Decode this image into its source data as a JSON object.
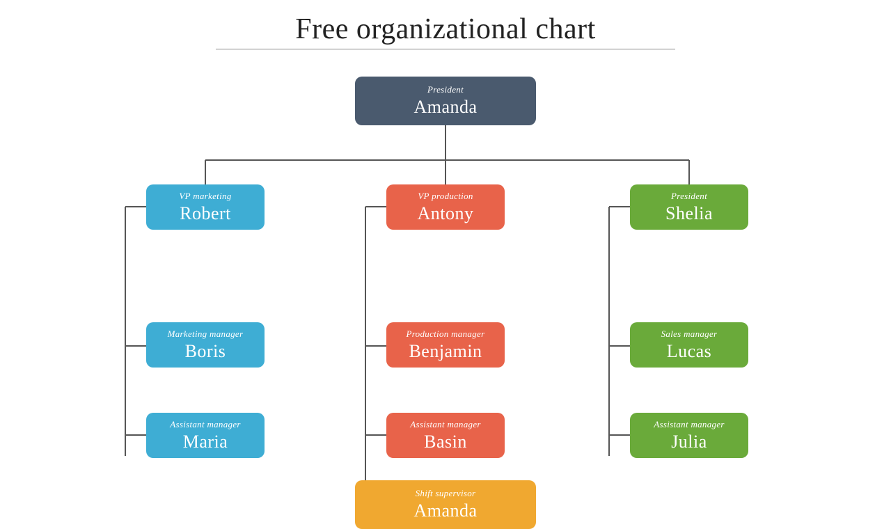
{
  "title": "Free organizational chart",
  "nodes": {
    "president": {
      "role": "President",
      "name": "Amanda"
    },
    "vp_marketing": {
      "role": "VP marketing",
      "name": "Robert"
    },
    "vp_production": {
      "role": "VP production",
      "name": "Antony"
    },
    "president2": {
      "role": "President",
      "name": "Shelia"
    },
    "marketing_manager": {
      "role": "Marketing manager",
      "name": "Boris"
    },
    "production_manager": {
      "role": "Production manager",
      "name": "Benjamin"
    },
    "sales_manager": {
      "role": "Sales manager",
      "name": "Lucas"
    },
    "asst_maria": {
      "role": "Assistant manager",
      "name": "Maria"
    },
    "asst_basin": {
      "role": "Assistant manager",
      "name": "Basin"
    },
    "asst_julia": {
      "role": "Assistant manager",
      "name": "Julia"
    },
    "shift_amanda": {
      "role": "Shift supervisor",
      "name": "Amanda"
    }
  }
}
